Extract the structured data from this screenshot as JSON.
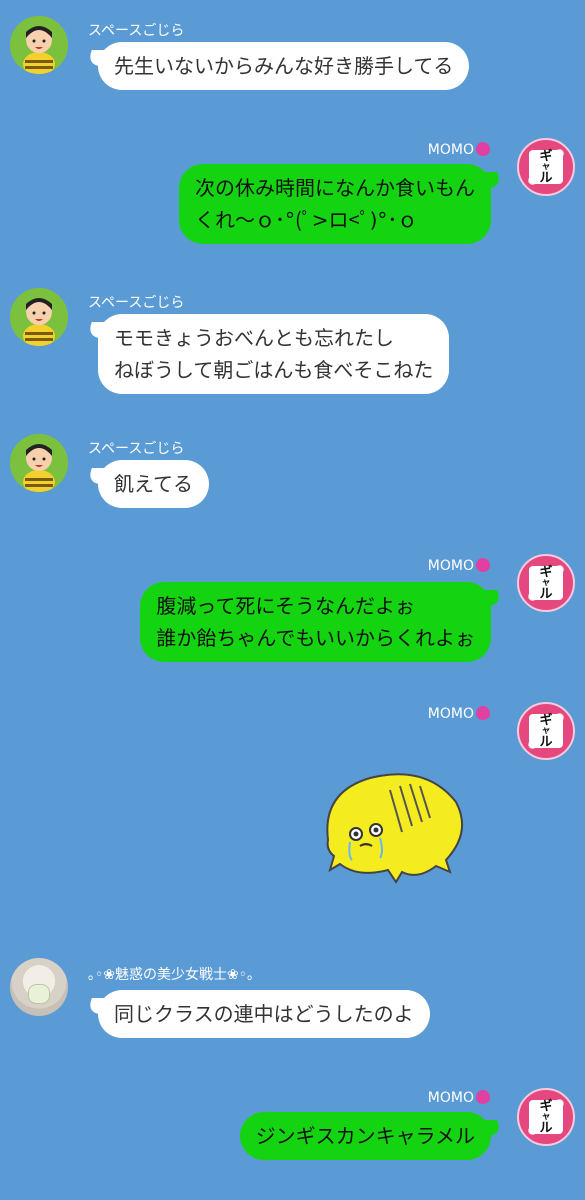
{
  "messages": [
    {
      "sender": "スペースごじら",
      "side": "left",
      "text": [
        "先生いないからみんな好き勝手してる"
      ]
    },
    {
      "sender": "MOMO",
      "side": "right",
      "text": [
        "次の休み時間になんか食いもん",
        "くれ〜ｏ･°(ﾟ>ロ<ﾟ)°･ｏ"
      ]
    },
    {
      "sender": "スペースごじら",
      "side": "left",
      "text": [
        "モモきょうおべんとも忘れたし",
        "ねぼうして朝ごはんも食べそこねた"
      ]
    },
    {
      "sender": "スペースごじら",
      "side": "left",
      "text": [
        "飢えてる"
      ]
    },
    {
      "sender": "MOMO",
      "side": "right",
      "text": [
        "腹減って死にそうなんだよぉ",
        "誰か飴ちゃんでもいいからくれよぉ"
      ]
    },
    {
      "sender": "MOMO",
      "side": "right",
      "sticker": "crying-chick-sticker"
    },
    {
      "sender": "｡◦❀魅惑の美少女戦士❀◦｡",
      "side": "left",
      "text": [
        "同じクラスの連中はどうしたのよ"
      ]
    },
    {
      "sender": "MOMO",
      "side": "right",
      "text": [
        "ジンギスカンキャラメル"
      ]
    }
  ],
  "avatars": {
    "gyaru_text": [
      "ギ",
      "ャ",
      "ル"
    ]
  },
  "colors": {
    "background": "#5b9bd5",
    "incoming_bubble": "#ffffff",
    "outgoing_bubble": "#14d412",
    "name_text": "#ffffff"
  }
}
